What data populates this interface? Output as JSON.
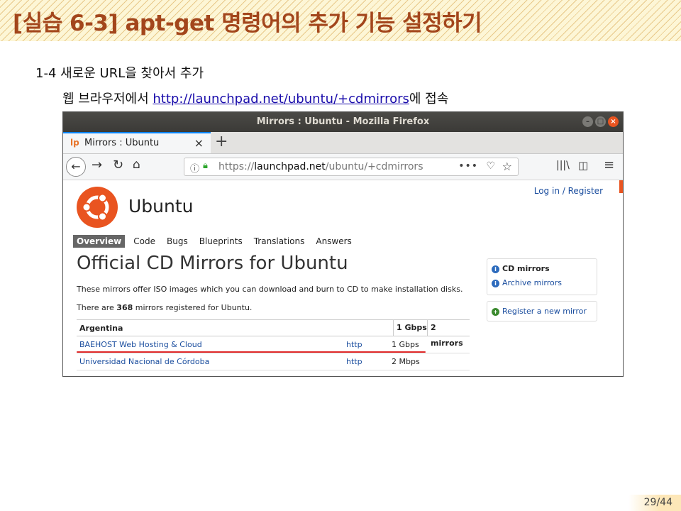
{
  "slide": {
    "title": "[실습 6-3] apt-get 명령어의 추가 기능 설정하기",
    "step": "1-4 새로운 URL을 찾아서 추가",
    "instruction_prefix": "웹 브라우저에서 ",
    "instruction_url": "http://launchpad.net/ubuntu/+cdmirrors",
    "instruction_suffix": "에  접속",
    "page_number": "29/44"
  },
  "browser": {
    "window_title": "Mirrors : Ubuntu - Mozilla Firefox",
    "tab_favicon": "lp",
    "tab_title": "Mirrors : Ubuntu",
    "tab_close": "×",
    "new_tab": "+",
    "url_scheme": "https://",
    "url_host": "launchpad.net",
    "url_path": "/ubuntu/+cdmirrors",
    "url_actions": "•••"
  },
  "page": {
    "login": "Log in / Register",
    "brand": "Ubuntu",
    "nav": [
      "Overview",
      "Code",
      "Bugs",
      "Blueprints",
      "Translations",
      "Answers"
    ],
    "heading": "Official CD Mirrors for Ubuntu",
    "description": "These mirrors offer ISO images which you can download and burn to CD to make installation disks.",
    "count_prefix": "There are ",
    "count_value": "368",
    "count_suffix": " mirrors registered for Ubuntu.",
    "table_header": {
      "country": "Argentina",
      "speed": "1 Gbps",
      "count": "2 mirrors"
    },
    "rows": [
      {
        "name": "BAEHOST Web Hosting & Cloud",
        "protocol": "http",
        "speed": "1 Gbps"
      },
      {
        "name": "Universidad Nacional de Córdoba",
        "protocol": "http",
        "speed": "2 Mbps"
      }
    ],
    "sidebar": {
      "cd_mirrors": "CD mirrors",
      "archive_mirrors": "Archive mirrors",
      "register": "Register a new mirror"
    }
  },
  "colors": {
    "title": "#a3461c",
    "ubuntu_orange": "#e95420",
    "link": "#1a4d9e",
    "highlight_line": "#e02a2a"
  }
}
